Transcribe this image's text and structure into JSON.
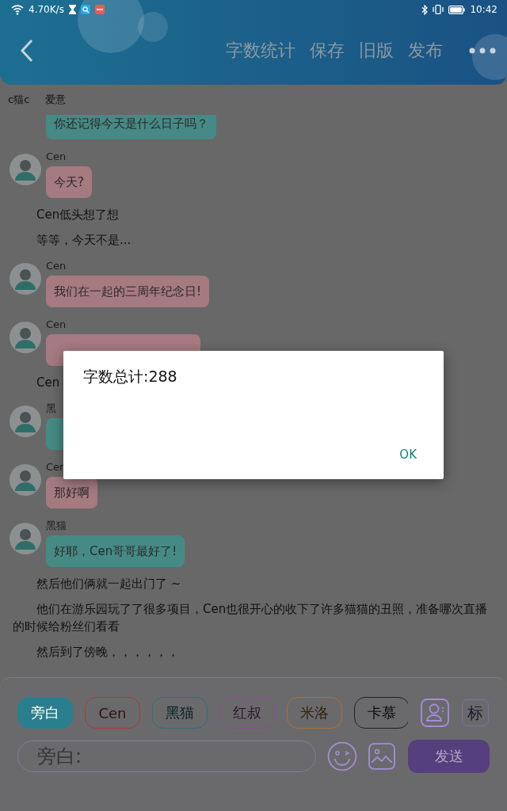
{
  "status_bar": {
    "network_speed": "4.70K/s",
    "time": "10:42"
  },
  "toolbar": {
    "actions": [
      "字数统计",
      "保存",
      "旧版",
      "发布"
    ]
  },
  "doc_tabs": [
    "c猫c",
    "爱意"
  ],
  "messages": [
    {
      "kind": "bubble",
      "text": "你还记得今天是什么日子吗？",
      "color": "#468a85"
    },
    {
      "kind": "bubble",
      "speaker": "Cen",
      "text": "今天?",
      "color": "#a57a80"
    },
    {
      "kind": "narration",
      "text": "Cen低头想了想"
    },
    {
      "kind": "narration",
      "text": "等等，今天不是..."
    },
    {
      "kind": "bubble",
      "speaker": "Cen",
      "text": "我们在一起的三周年纪念日!",
      "color": "#a57a80"
    },
    {
      "kind": "bubble",
      "speaker": "Cen",
      "color": "#a57a80"
    },
    {
      "kind": "narration",
      "text": "Cen"
    },
    {
      "kind": "bubble",
      "speaker": "黑",
      "color": "#468a85"
    },
    {
      "kind": "bubble",
      "speaker": "Cen",
      "text": "那好啊",
      "color": "#a57a80"
    },
    {
      "kind": "bubble",
      "speaker": "黑猫",
      "text": "好耶，Cen哥哥最好了!",
      "color": "#468a85"
    },
    {
      "kind": "narration",
      "text": "然后他们俩就一起出门了 ~"
    },
    {
      "kind": "narration",
      "text": "他们在游乐园玩了了很多项目，Cen也很开心的收下了许多猫猫的丑照，准备哪次直播的时候给粉丝们看看"
    },
    {
      "kind": "narration",
      "text": "然后到了傍晚，，，，，，"
    }
  ],
  "characters": [
    {
      "label": "旁白",
      "selected": true,
      "color": "#2a7f8e"
    },
    {
      "label": "Cen",
      "selected": false,
      "color": "#a83a3a"
    },
    {
      "label": "黑猫",
      "selected": false,
      "color": "#2f6f78"
    },
    {
      "label": "红叔",
      "selected": false,
      "color": "#8f4a98"
    },
    {
      "label": "米洛",
      "selected": false,
      "color": "#a8703a"
    },
    {
      "label": "卡慕",
      "selected": false,
      "color": "#222222"
    }
  ],
  "mark_button": "标",
  "input": {
    "placeholder": "旁白:"
  },
  "send_button": "发送",
  "dialog": {
    "message": "字数总计:288",
    "button": "OK"
  }
}
